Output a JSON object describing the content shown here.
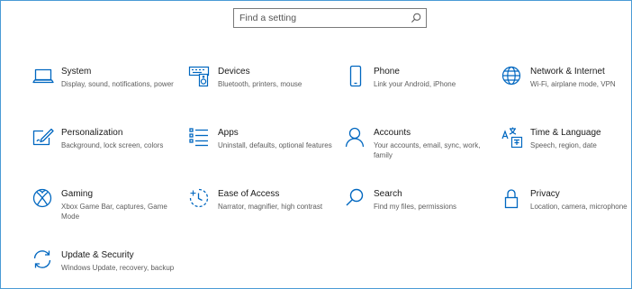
{
  "search": {
    "placeholder": "Find a setting",
    "value": ""
  },
  "accent_color": "#0067c0",
  "categories": [
    {
      "title": "System",
      "description": "Display, sound, notifications, power",
      "icon": "laptop-icon"
    },
    {
      "title": "Devices",
      "description": "Bluetooth, printers, mouse",
      "icon": "keyboard-speaker-icon"
    },
    {
      "title": "Phone",
      "description": "Link your Android, iPhone",
      "icon": "phone-icon"
    },
    {
      "title": "Network & Internet",
      "description": "Wi-Fi, airplane mode, VPN",
      "icon": "globe-icon"
    },
    {
      "title": "Personalization",
      "description": "Background, lock screen, colors",
      "icon": "pen-tablet-icon"
    },
    {
      "title": "Apps",
      "description": "Uninstall, defaults, optional features",
      "icon": "app-list-icon"
    },
    {
      "title": "Accounts",
      "description": "Your accounts, email, sync, work, family",
      "icon": "person-icon"
    },
    {
      "title": "Time & Language",
      "description": "Speech, region, date",
      "icon": "time-language-icon"
    },
    {
      "title": "Gaming",
      "description": "Xbox Game Bar, captures, Game Mode",
      "icon": "xbox-icon"
    },
    {
      "title": "Ease of Access",
      "description": "Narrator, magnifier, high contrast",
      "icon": "ease-of-access-icon"
    },
    {
      "title": "Search",
      "description": "Find my files, permissions",
      "icon": "magnifier-icon"
    },
    {
      "title": "Privacy",
      "description": "Location, camera, microphone",
      "icon": "lock-icon"
    },
    {
      "title": "Update & Security",
      "description": "Windows Update, recovery, backup",
      "icon": "sync-arrows-icon"
    }
  ]
}
